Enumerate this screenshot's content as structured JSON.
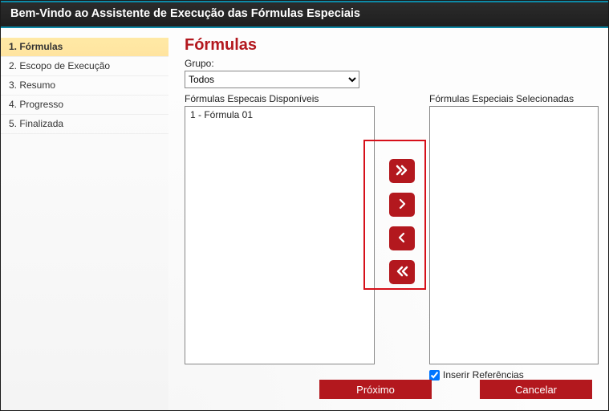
{
  "header": {
    "title": "Bem-Vindo ao Assistente de Execução das Fórmulas Especiais"
  },
  "sidebar": {
    "steps": [
      {
        "label": "1. Fórmulas",
        "active": true
      },
      {
        "label": "2. Escopo de Execução",
        "active": false
      },
      {
        "label": "3. Resumo",
        "active": false
      },
      {
        "label": "4. Progresso",
        "active": false
      },
      {
        "label": "5. Finalizada",
        "active": false
      }
    ]
  },
  "main": {
    "title": "Fórmulas",
    "group_label": "Grupo:",
    "group_selected": "Todos",
    "available_label": "Fórmulas Especais Disponíveis",
    "selected_label": "Fórmulas Especiais Selecionadas",
    "available_items": [
      "1 - Fórmula 01"
    ],
    "selected_items": [],
    "insert_refs_label": "Inserir Referências",
    "insert_refs_checked": true
  },
  "transfer": {
    "add_all": "add-all",
    "add_one": "add-one",
    "remove_one": "remove-one",
    "remove_all": "remove-all"
  },
  "footer": {
    "next": "Próximo",
    "cancel": "Cancelar"
  }
}
